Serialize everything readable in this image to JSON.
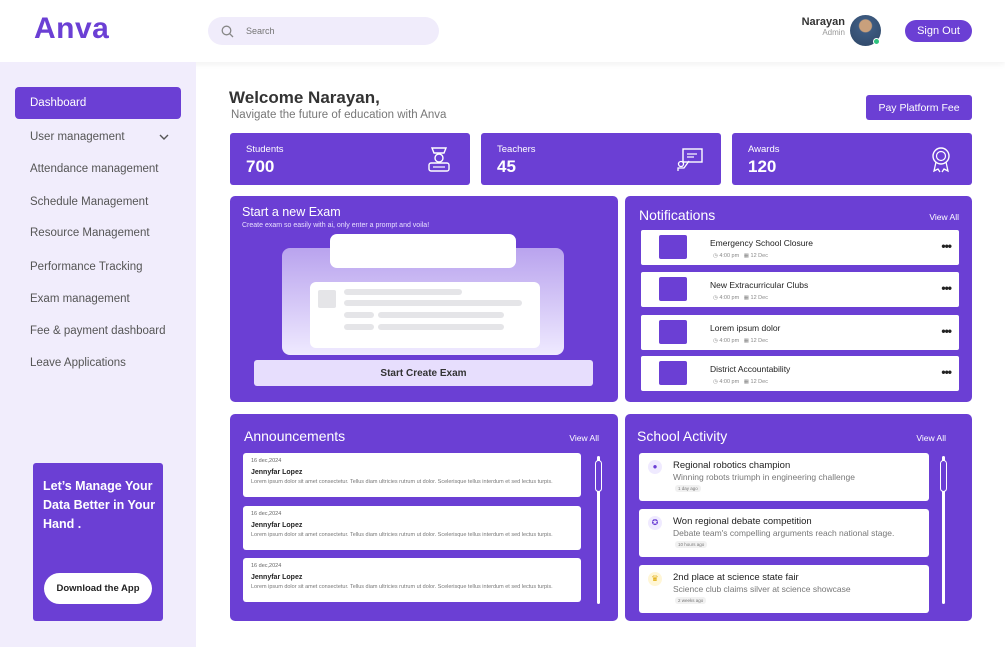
{
  "app": {
    "logo": "Anva"
  },
  "search": {
    "placeholder": "Search"
  },
  "user": {
    "name": "Narayan",
    "role": "Admin",
    "signout_label": "Sign Out"
  },
  "sidebar": {
    "items": [
      {
        "label": "Dashboard",
        "active": true
      },
      {
        "label": "User management",
        "has_chevron": true
      },
      {
        "label": "Attendance management"
      },
      {
        "label": "Schedule Management"
      },
      {
        "label": "Resource Management"
      },
      {
        "label": "Performance Tracking"
      },
      {
        "label": "Exam management"
      },
      {
        "label": "Fee & payment dashboard"
      },
      {
        "label": "Leave Applications"
      }
    ],
    "promo": {
      "text": "Let’s Manage Your Data Better in Your Hand .",
      "button": "Download the App"
    }
  },
  "header": {
    "welcome": "Welcome Narayan,",
    "subtitle": "Navigate the future of education with Anva",
    "pay_fee": "Pay Platform Fee"
  },
  "stats": [
    {
      "label": "Students",
      "value": "700",
      "icon": "student-icon"
    },
    {
      "label": "Teachers",
      "value": "45",
      "icon": "teacher-board-icon"
    },
    {
      "label": "Awards",
      "value": "120",
      "icon": "award-badge-icon"
    }
  ],
  "exam": {
    "title": "Start a new Exam",
    "subtitle": "Create exam so easily with ai, only enter a prompt and voila!",
    "button": "Start Create Exam"
  },
  "notifications": {
    "title": "Notifications",
    "view_all": "View All",
    "items": [
      {
        "title": "Emergency School Closure",
        "time": "4:00 pm",
        "date": "12 Dec"
      },
      {
        "title": "New Extracurricular Clubs",
        "time": "4:00 pm",
        "date": "12 Dec"
      },
      {
        "title": "Lorem ipsum dolor",
        "time": "4:00 pm",
        "date": "12 Dec"
      },
      {
        "title": "District Accountability",
        "time": "4:00 pm",
        "date": "12 Dec"
      }
    ]
  },
  "announcements": {
    "title": "Announcements",
    "view_all": "View All",
    "items": [
      {
        "date": "16 dec,2024",
        "name": "Jennyfar Lopez",
        "text": "Lorem ipsum dolor sit amet consectetur. Tellus diam ultricies rutrum ut dolor. Scelerisque tellus interdum et sed lectus turpis."
      },
      {
        "date": "16 dec,2024",
        "name": "Jennyfar Lopez",
        "text": "Lorem ipsum dolor sit amet consectetur. Tellus diam ultricies rutrum ut dolor. Scelerisque tellus interdum et sed lectus turpis."
      },
      {
        "date": "16 dec,2024",
        "name": "Jennyfar Lopez",
        "text": "Lorem ipsum dolor sit amet consectetur. Tellus diam ultricies rutrum ut dolor. Scelerisque tellus interdum et sed lectus turpis."
      }
    ]
  },
  "activity": {
    "title": "School Activity",
    "view_all": "View All",
    "items": [
      {
        "title": "Regional robotics champion",
        "subtitle": "Winning robots triumph in engineering challenge",
        "tag": "1 day ago",
        "icon": "robot-icon"
      },
      {
        "title": "Won regional debate competition",
        "subtitle": "Debate team's compelling arguments reach national stage.",
        "tag": "10 hours ago",
        "icon": "ribbon-icon"
      },
      {
        "title": "2nd place at science state fair",
        "subtitle": "Science club claims silver at science showcase",
        "tag": "2 weeks ago",
        "icon": "crown-icon"
      }
    ]
  },
  "colors": {
    "accent": "#6b3fd4",
    "sidebar_bg": "#f1edfc",
    "light_accent": "#e7defd"
  }
}
